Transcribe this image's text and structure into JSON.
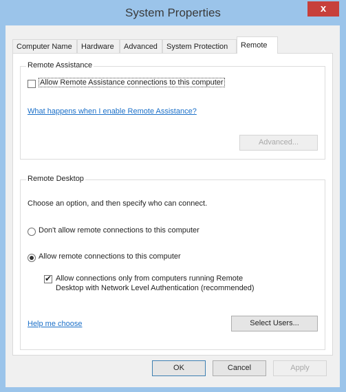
{
  "window": {
    "title": "System Properties",
    "close_label": "x"
  },
  "tabs": [
    {
      "label": "Computer Name"
    },
    {
      "label": "Hardware"
    },
    {
      "label": "Advanced"
    },
    {
      "label": "System Protection"
    },
    {
      "label": "Remote",
      "active": true
    }
  ],
  "remote_assistance": {
    "title": "Remote Assistance",
    "allow_label": "Allow Remote Assistance connections to this computer",
    "allow_checked": false,
    "help_link": "What happens when I enable Remote Assistance?",
    "advanced_label": "Advanced..."
  },
  "remote_desktop": {
    "title": "Remote Desktop",
    "intro": "Choose an option, and then specify who can connect.",
    "option_dont_allow": "Don't allow remote connections to this computer",
    "option_allow": "Allow remote connections to this computer",
    "selected_option": "allow",
    "nla_line1": "Allow connections only from computers running Remote",
    "nla_line2": "Desktop with Network Level Authentication (recommended)",
    "nla_checked": true,
    "help_link": "Help me choose",
    "select_users_label": "Select Users..."
  },
  "footer": {
    "ok_label": "OK",
    "cancel_label": "Cancel",
    "apply_label": "Apply"
  }
}
